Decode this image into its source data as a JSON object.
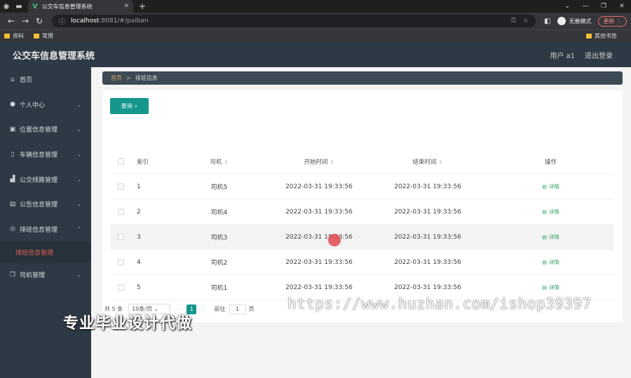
{
  "browser": {
    "tab_title": "公交车信息管理系统",
    "url_host": "localhost",
    "url_path": ":8081/#/paiban",
    "incognito_label": "无痕模式",
    "update_label": "更新",
    "bookmarks": [
      "资料",
      "常用"
    ],
    "bookmarks_right": "其他书签"
  },
  "header": {
    "title": "公交车信息管理系统",
    "user_label": "用户 a1",
    "logout_label": "退出登录"
  },
  "sidebar": {
    "items": [
      {
        "label": "首页",
        "icon": "home-icon"
      },
      {
        "label": "个人中心",
        "icon": "user-icon"
      },
      {
        "label": "位置信息管理",
        "icon": "location-icon"
      },
      {
        "label": "车辆信息管理",
        "icon": "vehicle-icon"
      },
      {
        "label": "公交线路管理",
        "icon": "route-icon"
      },
      {
        "label": "公告信息管理",
        "icon": "notice-icon"
      },
      {
        "label": "排班信息管理",
        "icon": "schedule-icon"
      },
      {
        "label": "司机管理",
        "icon": "driver-icon"
      }
    ],
    "active_sub": "排班信息管理"
  },
  "breadcrumb": {
    "home": "首页",
    "current": "排班信息"
  },
  "toolbar": {
    "query_label": "查询"
  },
  "table": {
    "headers": {
      "index": "索引",
      "driver": "司机",
      "start": "开始时间",
      "end": "结束时间",
      "ops": "操作"
    },
    "rows": [
      {
        "index": "1",
        "driver": "司机5",
        "start": "2022-03-31 19:33:56",
        "end": "2022-03-31 19:33:56",
        "op": "详情"
      },
      {
        "index": "2",
        "driver": "司机4",
        "start": "2022-03-31 19:33:56",
        "end": "2022-03-31 19:33:56",
        "op": "详情"
      },
      {
        "index": "3",
        "driver": "司机3",
        "start": "2022-03-31 19:33:56",
        "end": "2022-03-31 19:33:56",
        "op": "详情"
      },
      {
        "index": "4",
        "driver": "司机2",
        "start": "2022-03-31 19:33:56",
        "end": "2022-03-31 19:33:56",
        "op": "详情"
      },
      {
        "index": "5",
        "driver": "司机1",
        "start": "2022-03-31 19:33:56",
        "end": "2022-03-31 19:33:56",
        "op": "详情"
      }
    ]
  },
  "pagination": {
    "total": "共 5 条",
    "page_size": "10条/页",
    "current_page": "1",
    "goto_label": "前往",
    "goto_value": "1",
    "page_word": "页"
  },
  "watermark": {
    "url": "https://www.huzhan.com/ishop39397",
    "text": "专业毕业设计代做"
  }
}
